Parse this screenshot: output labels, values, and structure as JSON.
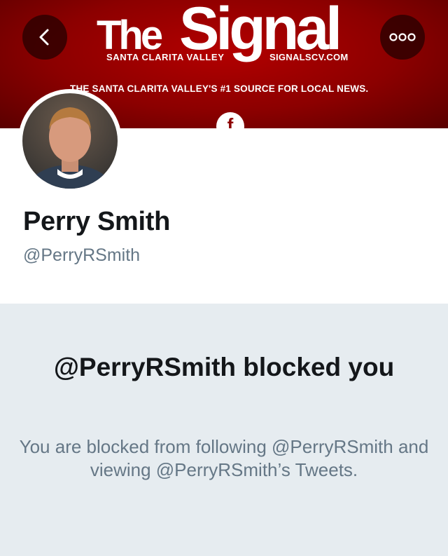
{
  "banner": {
    "logo_the": "The",
    "logo_signal": "Signal",
    "logo_location": "SANTA CLARITA VALLEY",
    "logo_site": "SIGNALSCV.COM",
    "tagline": "THE SANTA CLARITA VALLEY'S #1 SOURCE FOR LOCAL NEWS.",
    "facebook_glyph": "f",
    "background_color": "#9a0000"
  },
  "nav": {
    "back_icon": "chevron-left-icon",
    "more_icon": "more-dots-icon"
  },
  "profile": {
    "display_name": "Perry Smith",
    "handle": "@PerryRSmith"
  },
  "blocked": {
    "title": "@PerryRSmith blocked you",
    "description": "You are blocked from following @PerryRSmith and viewing @PerryRSmith’s Tweets."
  },
  "colors": {
    "text_primary": "#14171a",
    "text_secondary": "#657786",
    "blocked_bg": "#e6ecf0"
  }
}
